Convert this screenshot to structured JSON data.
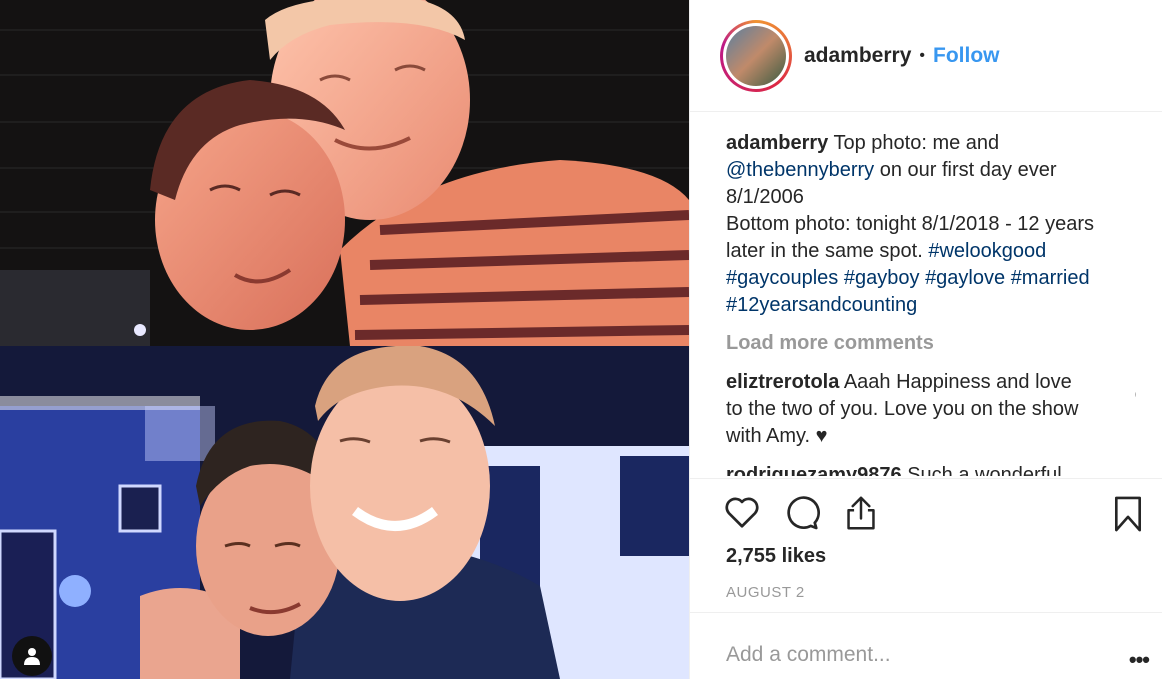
{
  "post": {
    "username": "adamberry",
    "follow_label": "Follow",
    "separator": "•",
    "caption": {
      "username": "adamberry",
      "text_1": " Top photo: me and ",
      "mention": "@thebennyberry",
      "text_2": " on our first day ever 8/1/2006",
      "text_3": "Bottom photo: tonight 8/1/2018 - 12 years later in the same spot. ",
      "hashtags": [
        "#welookgood",
        "#gaycouples",
        "#gayboy",
        "#gaylove",
        "#married",
        "#12yearsandcounting"
      ]
    },
    "load_more_label": "Load more comments",
    "comments": [
      {
        "username": "eliztrerotola",
        "text": "Aaah Happiness and love to the two of you. Love you on the show with Amy. ♥"
      },
      {
        "username": "rodriguezamy9876",
        "text": "Such a wonderful"
      }
    ],
    "likes": "2,755 likes",
    "date": "AUGUST 2",
    "add_comment_placeholder": "Add a comment...",
    "more_options": "•••"
  },
  "icons": {
    "like": "heart-icon",
    "comment": "comment-icon",
    "share": "share-icon",
    "save": "bookmark-icon",
    "tag": "user-tag-icon",
    "comment_like": "heart-icon"
  },
  "colors": {
    "accent": "#3897f0",
    "link": "#003569",
    "muted": "#999999",
    "text": "#262626",
    "border": "#efefef"
  }
}
